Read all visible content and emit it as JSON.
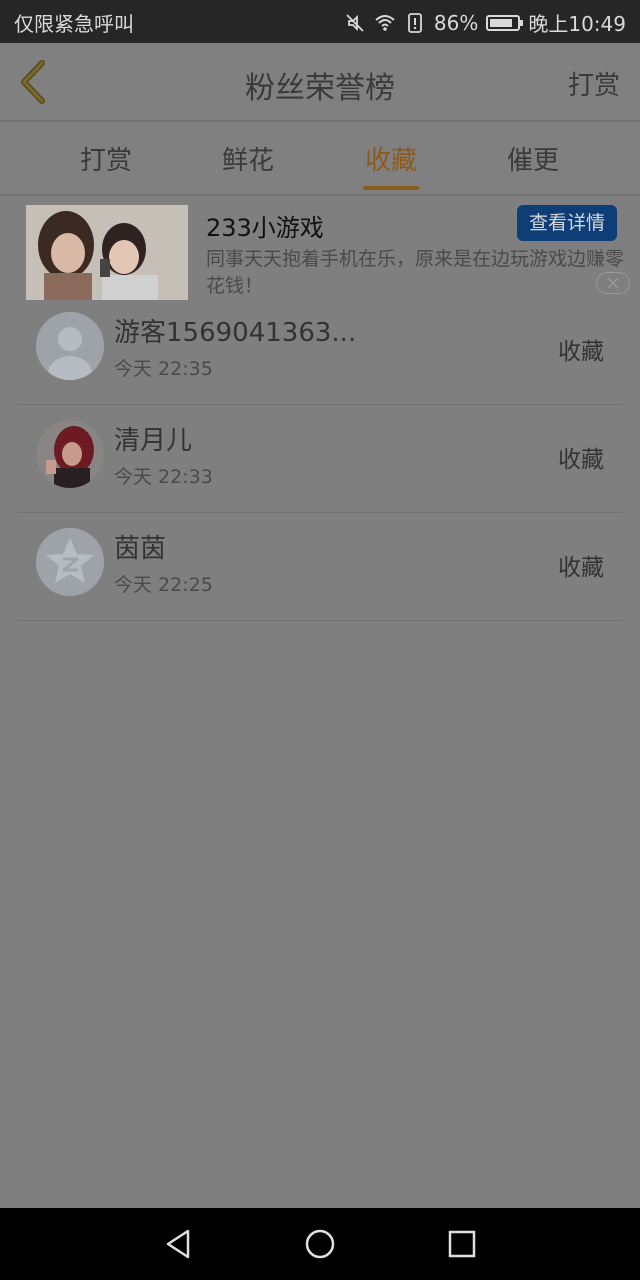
{
  "status_bar": {
    "carrier": "仅限紧急呼叫",
    "battery": "86%",
    "time": "晚上10:49",
    "battery_level": 0.86,
    "icons": [
      "mute-icon",
      "wifi-icon",
      "alert-icon",
      "battery-icon"
    ]
  },
  "header": {
    "title": "粉丝荣誉榜",
    "action_label": "打赏",
    "back_icon": "chevron-left-icon",
    "accent_color": "#8c5a1a"
  },
  "tabs": [
    {
      "label": "打赏",
      "active": false
    },
    {
      "label": "鲜花",
      "active": false
    },
    {
      "label": "收藏",
      "active": true
    },
    {
      "label": "催更",
      "active": false
    }
  ],
  "ad": {
    "title": "233小游戏",
    "button_label": "查看详情",
    "description": "同事天天抱着手机在乐，原来是在边玩游戏边赚零花钱！",
    "close_icon": "close-icon"
  },
  "list": [
    {
      "name": "游客1569041363...",
      "time": "今天 22:35",
      "action": "收藏",
      "avatar": "default-avatar-icon"
    },
    {
      "name": "清月儿",
      "time": "今天 22:33",
      "action": "收藏",
      "avatar": "photo-avatar"
    },
    {
      "name": "茵茵",
      "time": "今天 22:25",
      "action": "收藏",
      "avatar": "qq-avatar-icon"
    }
  ],
  "nav_bar": {
    "buttons": [
      "back-triangle-icon",
      "home-circle-icon",
      "recents-square-icon"
    ]
  }
}
